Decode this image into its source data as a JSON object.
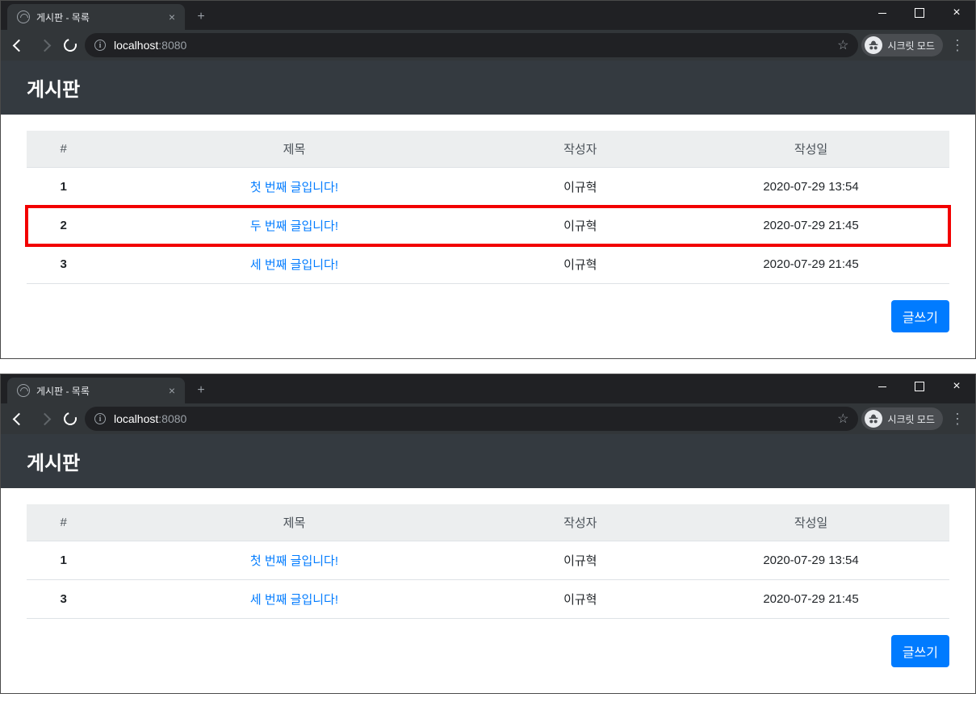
{
  "browser": {
    "tab_title": "게시판 - 목록",
    "url_host": "localhost",
    "url_port": ":8080",
    "incognito_label": "시크릿 모드"
  },
  "page": {
    "heading": "게시판",
    "columns": {
      "num": "#",
      "title": "제목",
      "author": "작성자",
      "date": "작성일"
    },
    "write_label": "글쓰기"
  },
  "windows": [
    {
      "highlight_index": 1,
      "rows": [
        {
          "num": "1",
          "title": "첫 번째 글입니다!",
          "author": "이규혁",
          "date": "2020-07-29 13:54"
        },
        {
          "num": "2",
          "title": "두 번째 글입니다!",
          "author": "이규혁",
          "date": "2020-07-29 21:45"
        },
        {
          "num": "3",
          "title": "세 번째 글입니다!",
          "author": "이규혁",
          "date": "2020-07-29 21:45"
        }
      ]
    },
    {
      "highlight_index": -1,
      "rows": [
        {
          "num": "1",
          "title": "첫 번째 글입니다!",
          "author": "이규혁",
          "date": "2020-07-29 13:54"
        },
        {
          "num": "3",
          "title": "세 번째 글입니다!",
          "author": "이규혁",
          "date": "2020-07-29 21:45"
        }
      ]
    }
  ]
}
